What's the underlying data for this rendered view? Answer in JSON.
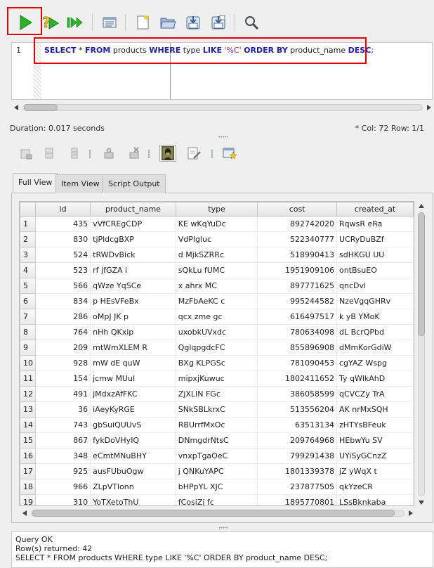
{
  "toolbar": {
    "execute_icon": "play-icon",
    "explain_icon": "question-icon",
    "execute_script_icon": "run-script-icon",
    "buttons": [
      "execute-button",
      "explain-button",
      "execute-script-button",
      "sql-log-button",
      "new-button",
      "open-button",
      "save-button",
      "save-as-button",
      "find-button"
    ]
  },
  "editor": {
    "line_number": "1",
    "sql": {
      "t1": "SELECT",
      "t2": " * ",
      "t3": "FROM",
      "t4": " products ",
      "t5": "WHERE",
      "t6": " type ",
      "t7": "LIKE",
      "t8": " ",
      "t9": "'%C'",
      "t10": " ",
      "t11": "ORDER BY",
      "t12": " product_name ",
      "t13": "DESC",
      "t14": ";"
    }
  },
  "status": {
    "duration": "Duration: 0.017 seconds",
    "position": "*  Col: 72 Row: 1/1"
  },
  "tabs": [
    {
      "label": "Full View",
      "active": true
    },
    {
      "label": "Item View",
      "active": false
    },
    {
      "label": "Script Output",
      "active": false
    }
  ],
  "grid": {
    "columns": [
      "id",
      "product_name",
      "type",
      "cost",
      "created_at"
    ],
    "rows": [
      [
        "1",
        "435",
        "vVfCREgCDP",
        "KE wKqYuDc",
        "892742020",
        "RqwsR eRa"
      ],
      [
        "2",
        "830",
        "tjPldcgBXP",
        "VdPlgluc",
        "522340777",
        "UCRyDuBZf"
      ],
      [
        "3",
        "524",
        "tRWDvBick",
        "d MjkSZRRc",
        "518990413",
        "sdHKGU UU"
      ],
      [
        "4",
        "523",
        "rf jfGZA i",
        "sQkLu fUMC",
        "1951909106",
        "ontBsuEO"
      ],
      [
        "5",
        "566",
        "qWze YqSCe",
        "x ahrx MC",
        "897771625",
        "qncDvl"
      ],
      [
        "6",
        "834",
        "p HEsVFeBx",
        "MzFbAeKC c",
        "995244582",
        "NzeVgqGHRv"
      ],
      [
        "7",
        "286",
        "oMpJ JK p",
        "qcx zme gc",
        "616497517",
        "k yB YMoK"
      ],
      [
        "8",
        "764",
        "nHh QKxip",
        "uxobkUVxdc",
        "780634098",
        "dL BcrQPbd"
      ],
      [
        "9",
        "209",
        "mtWmXLEM R",
        "QglqpgdcFC",
        "855896908",
        "dMmKorGdiW"
      ],
      [
        "10",
        "928",
        "mW dE quW",
        "BXg KLPGSc",
        "781090453",
        "cgYAZ Wspg"
      ],
      [
        "11",
        "154",
        "jcmw MUuI",
        "mipxjKuwuc",
        "1802411652",
        "Ty qWlkAhD"
      ],
      [
        "12",
        "491",
        "jMdxzAfFKC",
        "ZjXLIN FGc",
        "386058599",
        "qCVCZy TrA"
      ],
      [
        "13",
        "36",
        "iAeyKyRGE",
        "SNkSBLkrxC",
        "513556204",
        "AK nrMxSQH"
      ],
      [
        "14",
        "743",
        "gbSuiQUUvS",
        "RBUrrfMxOc",
        "63513134",
        "zHTYsBFeuk"
      ],
      [
        "15",
        "867",
        "fykDoVHyIQ",
        "DNmgdrNtsC",
        "209764968",
        "HEbwYu SV"
      ],
      [
        "16",
        "348",
        "eCmtMNuBHY",
        "vnxpTgaOeC",
        "799291438",
        "UYiSyGCnzZ"
      ],
      [
        "17",
        "925",
        "ausFUbuOgw",
        "j QNKuYAPC",
        "1801339378",
        "jZ yWqX t"
      ],
      [
        "18",
        "966",
        "ZLpVTlonn",
        "bHPpYL XJC",
        "237877505",
        "qkYzeCR"
      ],
      [
        "19",
        "310",
        "YoTXetoThU",
        "fCosiZj fc",
        "1895770801",
        "LSsBknkaba"
      ]
    ]
  },
  "messages": {
    "line1": "Query OK",
    "line2": "Row(s) returned: 42",
    "line3": "SELECT * FROM products WHERE type LIKE '%C' ORDER BY product_name DESC;"
  }
}
